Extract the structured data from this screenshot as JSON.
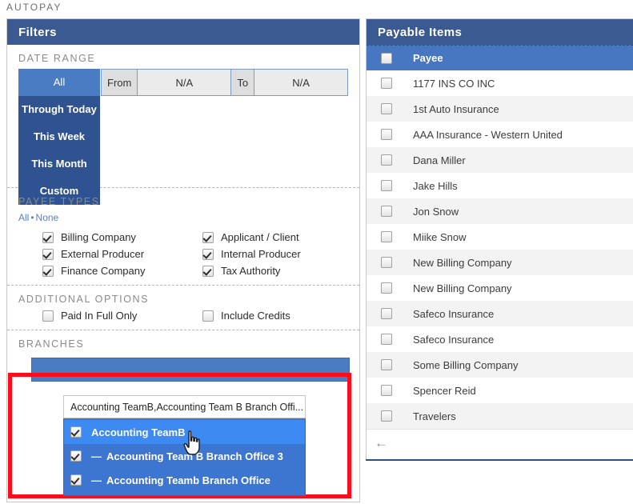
{
  "page": {
    "title": "AUTOPAY"
  },
  "filters": {
    "header": "Filters",
    "date_range": {
      "title": "DATE RANGE",
      "buttons": [
        {
          "label": "All",
          "active": true
        },
        {
          "label": "Through Today",
          "active": false
        },
        {
          "label": "This Week",
          "active": false
        },
        {
          "label": "This Month",
          "active": false
        },
        {
          "label": "Custom",
          "active": false
        }
      ],
      "from_label": "From",
      "from_value": "N/A",
      "to_label": "To",
      "to_value": "N/A"
    },
    "payee_types": {
      "title": "PAYEE TYPES",
      "all_link": "All",
      "separator": "•",
      "none_link": "None",
      "items": [
        {
          "label": "Billing Company",
          "checked": true
        },
        {
          "label": "Applicant / Client",
          "checked": true
        },
        {
          "label": "External Producer",
          "checked": true
        },
        {
          "label": "Internal Producer",
          "checked": true
        },
        {
          "label": "Finance Company",
          "checked": true
        },
        {
          "label": "Tax Authority",
          "checked": true
        }
      ]
    },
    "additional_options": {
      "title": "ADDITIONAL OPTIONS",
      "items": [
        {
          "label": "Paid In Full Only",
          "checked": false
        },
        {
          "label": "Include Credits",
          "checked": false
        }
      ]
    },
    "branches": {
      "title": "BRANCHES",
      "input_value": "Accounting TeamB,Accounting Team B Branch Offi...",
      "options": [
        {
          "label": "Accounting TeamB",
          "prefix": "",
          "checked": true,
          "hover": true
        },
        {
          "label": "Accounting Team B Branch Office 3",
          "prefix": "—",
          "checked": true,
          "hover": false
        },
        {
          "label": "Accounting Teamb Branch Office",
          "prefix": "—",
          "checked": true,
          "hover": false
        }
      ]
    }
  },
  "payable": {
    "header": "Payable Items",
    "column_header": "Payee",
    "header_checked": false,
    "footer_icon": "back-arrow-icon",
    "rows": [
      {
        "label": "1177 INS CO INC",
        "checked": false
      },
      {
        "label": "1st Auto Insurance",
        "checked": false
      },
      {
        "label": "AAA Insurance - Western United",
        "checked": false
      },
      {
        "label": "Dana Miller",
        "checked": false
      },
      {
        "label": "Jake Hills",
        "checked": false
      },
      {
        "label": "Jon Snow",
        "checked": false
      },
      {
        "label": "Miike Snow",
        "checked": false
      },
      {
        "label": "New Billing Company",
        "checked": false
      },
      {
        "label": "New Billing Company",
        "checked": false
      },
      {
        "label": "Safeco Insurance",
        "checked": false
      },
      {
        "label": "Safeco Insurance",
        "checked": false
      },
      {
        "label": "Some Billing Company",
        "checked": false
      },
      {
        "label": "Spencer Reid",
        "checked": false
      },
      {
        "label": "Travelers",
        "checked": false
      }
    ]
  },
  "colors": {
    "header_dark": "#3b5a91",
    "accent_blue": "#4a7cc4",
    "button_blue": "#2f5390",
    "highlight_red": "#fc0d1b",
    "dropdown_blue": "#3d76d0",
    "dropdown_hover": "#3d8bf2"
  }
}
